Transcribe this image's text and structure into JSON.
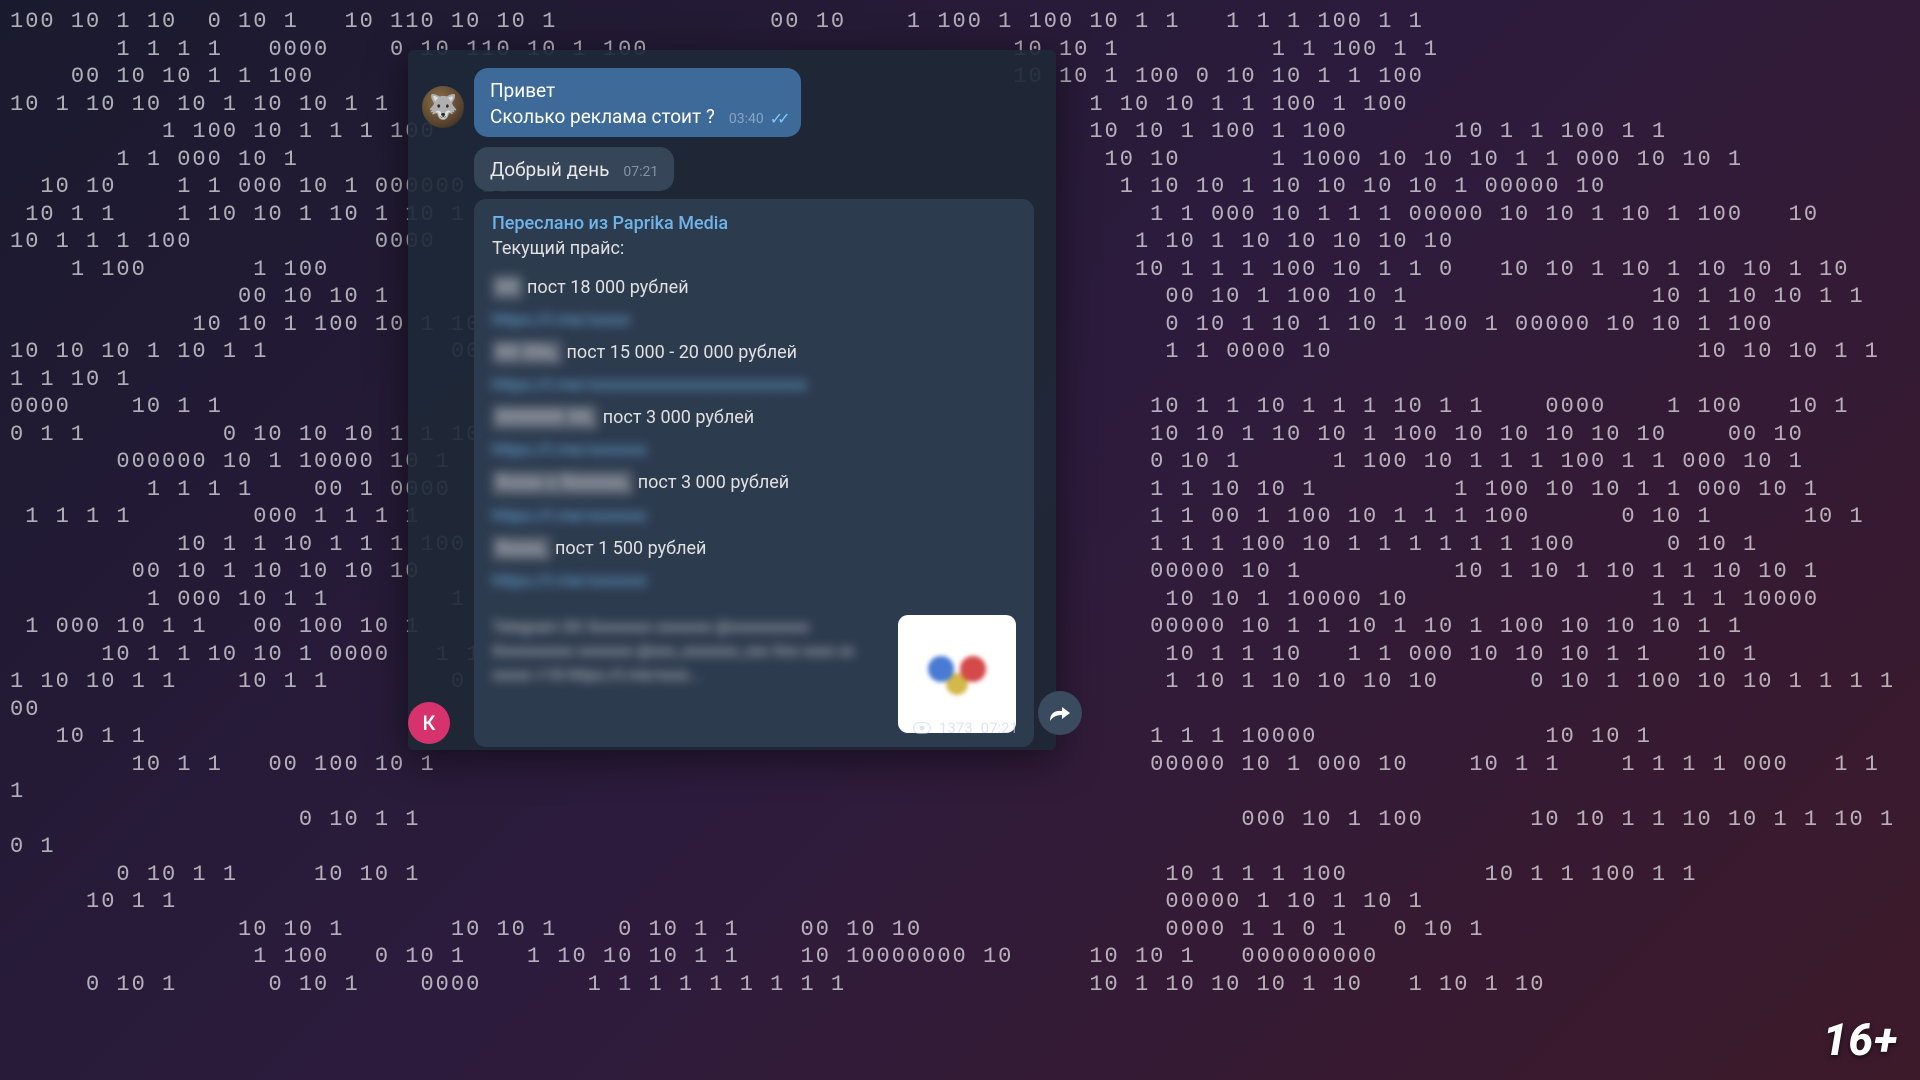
{
  "background_binary": "100 10 1 10  0 10 1   10 110 10 10 1              00 10    1 100 1 100 10 1 1   1 1 1 100 1 1\n       1 1 1 1   0000    0 10 110 10 1 100                        10 10 1          1 1 100 1 1\n    00 10 10 1 1 100                                              10 10 1 100 0 10 10 1 1 100\n10 1 10 10 10 1 10 10 1 1                                              1 10 10 1 1 100 1 100\n          1 100 10 1 1 1 100                                           10 10 1 100 1 100       10 1 1 100 1 1\n       1 1 000 10 1                                                     10 10      1 1000 10 10 10 1 1 000 10 10 1\n  10 10    1 1 000 10 1 000000 10                                        1 10 10 1 10 10 10 10 1 00000 10\n 10 1 1    1 10 10 1 10 1 10 1 1 1 1 1                                     1 1 000 10 1 1 1 00000 10 10 1 10 1 100   10\n10 1 1 1 100            0000                                              1 10 1 10 10 10 10 10\n    1 100       1 100                                                     10 1 1 1 100 10 1 1 0   10 10 1 10 1 10 10 1 10\n               00 10 10 1                                                   00 10 1 100 10 1                10 1 10 10 1 1\n            10 10 1 100 10 1 10 10 10 10                                    0 10 1 10 1 10 1 100 1 00000 10 10 1 100\n10 10 10 1 10 1 1            00 100 10 1                                    1 1 0000 10                        10 10 10 1 1 1 1 10 1\n0000    10 1 1                                                             10 1 1 10 1 1 1 10 1 1    0000    1 100   10 1\n0 1 1         0 10 10 10 1 1 100                                           10 10 1 10 10 1 100 10 10 10 10 10    00 10\n       000000 10 1 10000 10 1                                              0 10 1      1 100 10 1 1 1 100 1 1 000 10 1\n         1 1 1 1    00 1 0000                                              1 1 10 10 1         1 100 10 10 1 1 000 10 1\n 1 1 1 1        000 1 1 1 1                                                1 1 00 1 100 10 1 1 1 100      0 10 1      10 1\n           10 1 1 10 1 1 1 100                                             1 1 1 100 10 1 1 1 1 1 1 100      0 10 1\n        00 10 1 10 10 10 10                                                00000 10 1          10 1 10 1 10 1 1 10 10 1\n         1 000 10 1 1        1 1 1 1                                        10 10 1 10000 10                1 1 1 10000\n 1 000 10 1 1   00 100 10 1                                                00000 10 1 1 10 1 10 1 100 10 10 10 1 1\n      10 1 1 10 10 1 0000   1 1 1 1                                         10 1 1 10   1 1 000 10 10 10 1 1   10 1\n1 10 10 1 1    10 1 1        0 10 1                                         1 10 1 10 10 10 10      0 10 1 100 10 10 1 1 1 100\n   10 1 1                                                                  1 1 1 10000               10 10 1\n        10 1 1   00 100 10 1                                               00000 10 1 000 10    10 1 1    1 1 1 1 000   1 1 1\n                   0 10 1 1                                                      000 10 1 100       10 10 1 1 10 10 1 1 10 10 1\n       0 10 1 1     10 10 1                                                 10 1 1 1 100         10 1 1 100 1 1\n     10 1 1                                                                 00000 1 10 1 10 1\n               10 10 1       10 10 1    0 10 1 1    00 10 10                0000 1 1 0 1   0 10 1\n                1 100   0 10 1    1 10 10 10 1 1    10 10000000 10     10 10 1   000000000\n     0 10 1      0 10 1    0000       1 1 1 1 1 1 1 1 1                10 1 10 10 10 1 10   1 10 1 10",
  "chat": {
    "message1": {
      "line1": "Привет",
      "line2": "Сколько реклама стоит ?",
      "time": "03:40"
    },
    "message2": {
      "text": "Добрый день",
      "time": "07:21"
    },
    "forwarded": {
      "header": "Переслано из Paprika Media",
      "subheader": "Текущий прайс:",
      "items": [
        {
          "prefix_blur": "XX",
          "text": " пост 18 000 рублей",
          "link_blur": "https://t.me/xxxxx"
        },
        {
          "prefix_blur": "XX XXx,",
          "text": " пост 15 000 - 20 000 рублей",
          "link_blur": "https://t.me/xxxxxxxxxxxxxxxxxxxxxxxxxx"
        },
        {
          "prefix_blur": "XXXXXX XX,",
          "text": " пост 3 000 рублей",
          "link_blur": "https://t.me/xxxxxxx"
        },
        {
          "prefix_blur": "Xxxxx x Xxxxxxx,",
          "text": " пост 3 000 рублей",
          "link_blur": "https://t.me/xxxxxxx"
        },
        {
          "prefix_blur": "Xxxxx,",
          "text": " пост 1 500 рублей",
          "link_blur": "https://t.me/xxxxxxx"
        }
      ],
      "preview_text": "Telegram\nXX\nXxxxxxxx xxxxxxx @xxxxxxxxxx\nXxxxxxxxxx xxxxxxx  @xxx_xxxxxxx_xxx\nXxx xxxx xx xxxxx +18  https://t.me/xxxx...",
      "views": "1373",
      "time": "07:21"
    },
    "avatar2_initial": "К"
  },
  "age_rating": "16+"
}
